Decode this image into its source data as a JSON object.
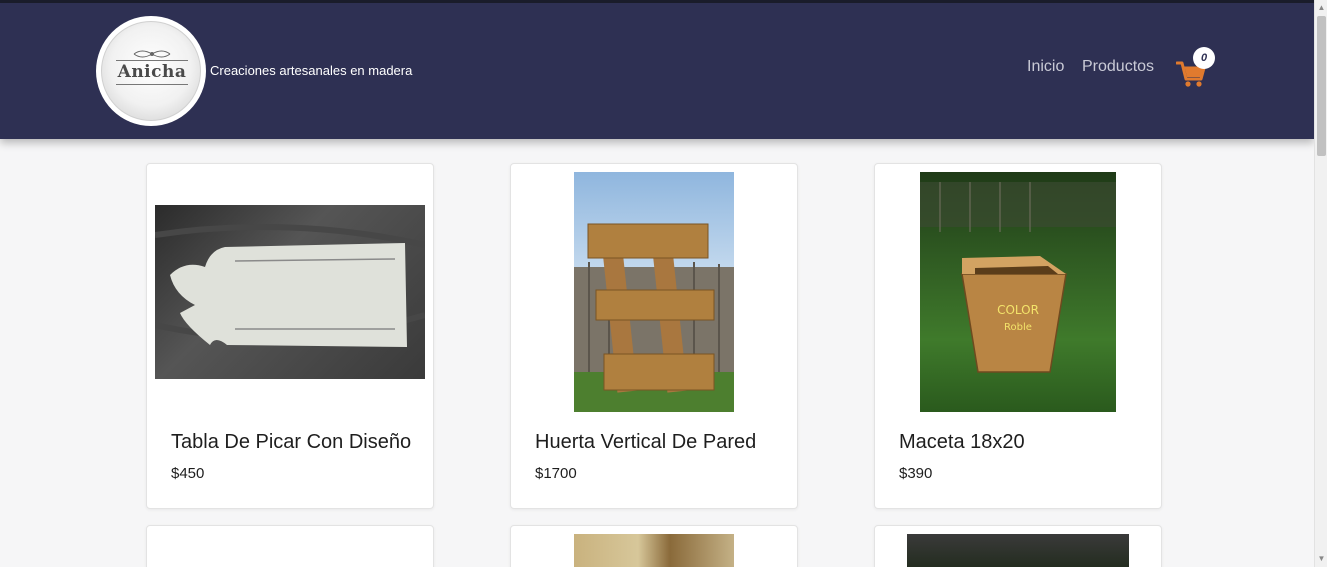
{
  "header": {
    "logo_text": "Anicha",
    "tagline": "Creaciones artesanales en madera",
    "nav": [
      {
        "label": "Inicio"
      },
      {
        "label": "Productos"
      }
    ],
    "cart_count": "0"
  },
  "products": [
    {
      "title": "Tabla De Picar Con Diseño",
      "price": "$450"
    },
    {
      "title": "Huerta Vertical De Pared",
      "price": "$1700"
    },
    {
      "title": "Maceta 18x20",
      "price": "$390"
    }
  ],
  "colors": {
    "header_bg": "#2e3053",
    "cart_orange": "#e07a2e",
    "page_bg": "#f6f6f7"
  }
}
